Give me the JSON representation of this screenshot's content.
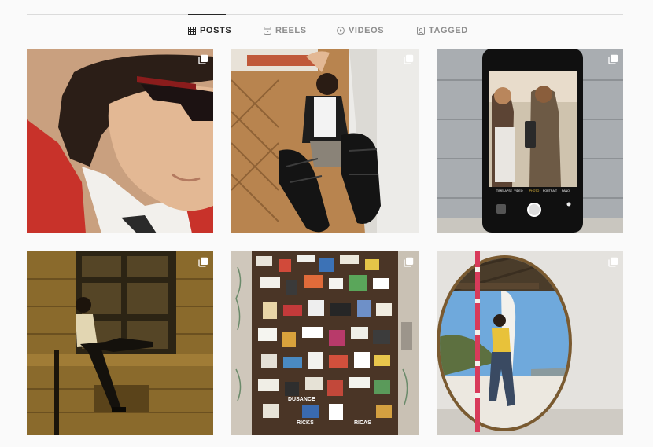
{
  "tabs": [
    {
      "label": "POSTS",
      "icon": "grid-icon",
      "active": true
    },
    {
      "label": "REELS",
      "icon": "reels-icon",
      "active": false
    },
    {
      "label": "VIDEOS",
      "icon": "play-icon",
      "active": false
    },
    {
      "label": "TAGGED",
      "icon": "tag-icon",
      "active": false
    }
  ],
  "posts": [
    {
      "icon": "carousel-icon"
    },
    {
      "icon": "carousel-icon"
    },
    {
      "icon": "carousel-icon"
    },
    {
      "icon": "carousel-icon"
    },
    {
      "icon": "carousel-icon"
    },
    {
      "icon": "carousel-icon"
    }
  ],
  "camera_modes": [
    "TIMELAPSE",
    "VIDEO",
    "PHOTO",
    "PORTRAIT",
    "PANO"
  ],
  "stickers": [
    "DUSANCE",
    "RICKS",
    "RICAS"
  ],
  "colors": {
    "active": "#262626",
    "inactive": "#8e8e8e",
    "divider": "#dbdbdb",
    "background": "#fafafa"
  }
}
